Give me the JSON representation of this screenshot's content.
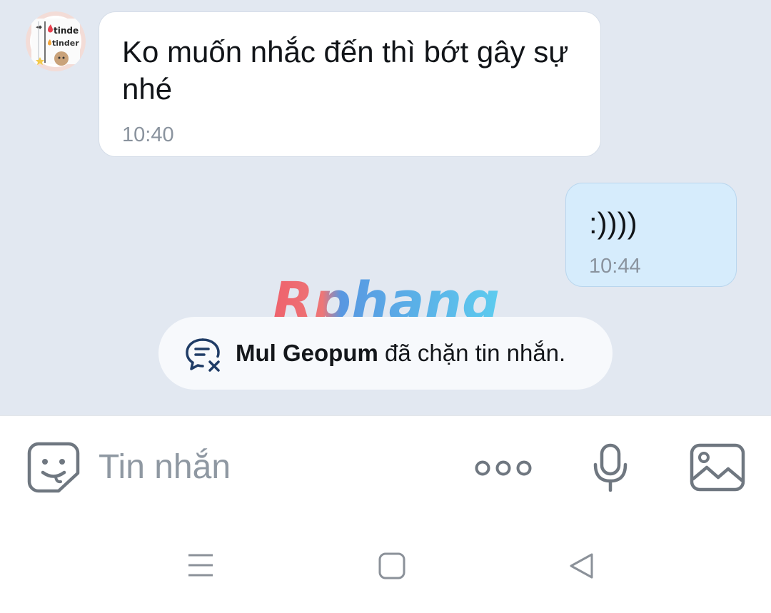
{
  "chat": {
    "messages": [
      {
        "direction": "incoming",
        "text": "Ko muốn nhắc đến thì bớt gây sự nhé",
        "time": "10:40"
      },
      {
        "direction": "outgoing",
        "text": ":))))",
        "time": "10:44"
      }
    ],
    "avatar_text": [
      "tinde",
      "tinder"
    ],
    "system_notice": {
      "name": "Mul Geopum",
      "text": " đã chặn tin nhắn."
    }
  },
  "watermark": "Rphang",
  "composer": {
    "placeholder": "Tin nhắn"
  },
  "icons": {
    "emoji": "sticker-face-icon",
    "more": "more-dots-icon",
    "mic": "microphone-icon",
    "image": "image-gallery-icon",
    "blocked": "blocked-chat-icon",
    "nav": [
      "menu-lines-icon",
      "home-square-icon",
      "back-triangle-icon"
    ]
  },
  "colors": {
    "chat_bg": "#e2e8f1",
    "outgoing_bubble": "#d6ecfc",
    "incoming_bubble": "#ffffff",
    "icon_gray": "#6f7780",
    "accent": "#1f3c66"
  }
}
